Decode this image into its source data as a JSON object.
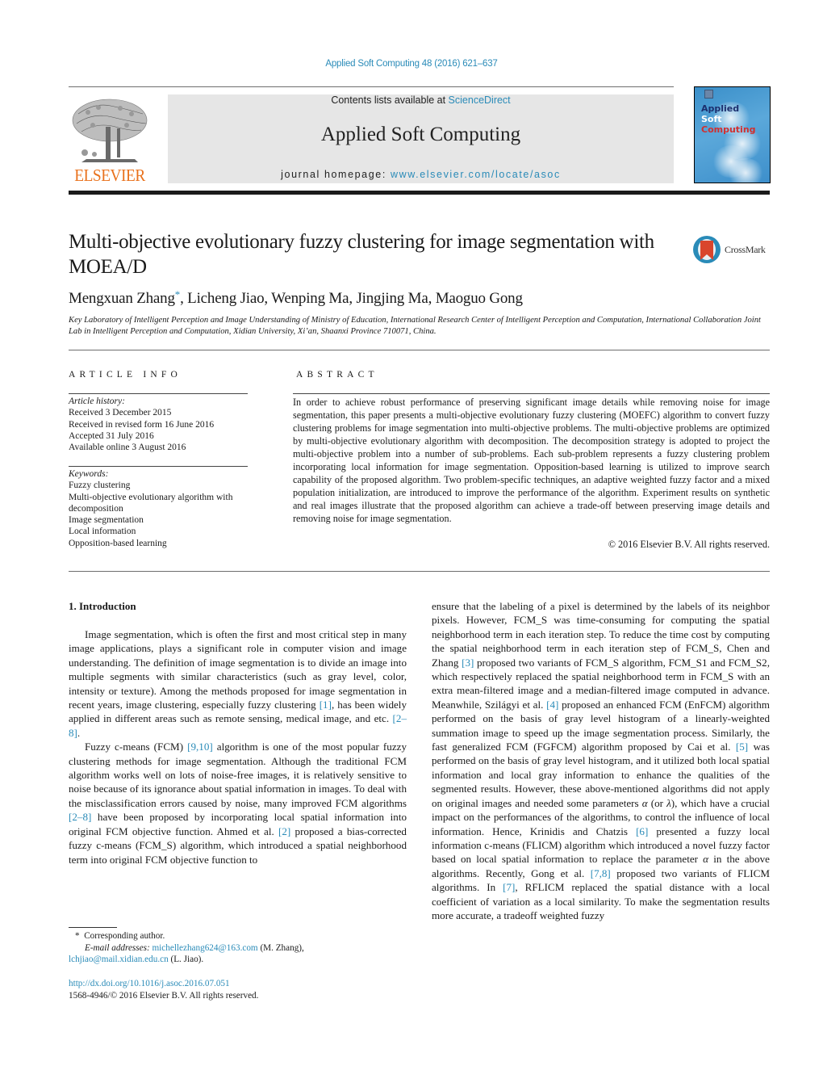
{
  "header": {
    "journal_ref": "Applied Soft Computing 48 (2016) 621–637",
    "contents_prefix": "Contents lists available at ",
    "contents_link": "ScienceDirect",
    "journal_title": "Applied Soft Computing",
    "homepage_prefix": "journal homepage: ",
    "homepage_link": "www.elsevier.com/locate/asoc",
    "publisher_logo_text": "ELSEVIER",
    "cover": {
      "line1": "Applied",
      "line2": "Soft",
      "line3": "Computing"
    },
    "colors": {
      "link": "#2a8bb8",
      "elsevier_orange": "#e9711c",
      "header_bg": "#e6e6e6"
    }
  },
  "article": {
    "title": "Multi-objective evolutionary fuzzy clustering for image segmentation with MOEA/D",
    "crossmark_label": "CrossMark",
    "authors": [
      {
        "name": "Mengxuan Zhang",
        "mark": "*"
      },
      {
        "name": "Licheng Jiao",
        "mark": ""
      },
      {
        "name": "Wenping Ma",
        "mark": ""
      },
      {
        "name": "Jingjing Ma",
        "mark": ""
      },
      {
        "name": "Maoguo Gong",
        "mark": ""
      }
    ],
    "affiliation": "Key Laboratory of Intelligent Perception and Image Understanding of Ministry of Education, International Research Center of Intelligent Perception and Computation, International Collaboration Joint Lab in Intelligent Perception and Computation, Xidian University, Xi’an, Shaanxi Province 710071, China."
  },
  "article_info": {
    "heading": "ARTICLE INFO",
    "history_label": "Article history:",
    "history": [
      "Received 3 December 2015",
      "Received in revised form 16 June 2016",
      "Accepted 31 July 2016",
      "Available online 3 August 2016"
    ],
    "keywords_label": "Keywords:",
    "keywords": [
      "Fuzzy clustering",
      "Multi-objective evolutionary algorithm with decomposition",
      "Image segmentation",
      "Local information",
      "Opposition-based learning"
    ]
  },
  "abstract": {
    "heading": "ABSTRACT",
    "text": "In order to achieve robust performance of preserving significant image details while removing noise for image segmentation, this paper presents a multi-objective evolutionary fuzzy clustering (MOEFC) algorithm to convert fuzzy clustering problems for image segmentation into multi-objective problems. The multi-objective problems are optimized by multi-objective evolutionary algorithm with decomposition. The decomposition strategy is adopted to project the multi-objective problem into a number of sub-problems. Each sub-problem represents a fuzzy clustering problem incorporating local information for image segmentation. Opposition-based learning is utilized to improve search capability of the proposed algorithm. Two problem-specific techniques, an adaptive weighted fuzzy factor and a mixed population initialization, are introduced to improve the performance of the algorithm. Experiment results on synthetic and real images illustrate that the proposed algorithm can achieve a trade-off between preserving image details and removing noise for image segmentation.",
    "copyright": "© 2016 Elsevier B.V. All rights reserved."
  },
  "body": {
    "section_heading": "1.  Introduction",
    "left_paragraphs": [
      [
        {
          "t": "Image segmentation, which is often the first and most critical step in many image applications, plays a significant role in computer vision and image understanding. The definition of image segmentation is to divide an image into multiple segments with similar characteristics (such as gray level, color, intensity or texture). Among the methods proposed for image segmentation in recent years, image clustering, especially fuzzy clustering "
        },
        {
          "c": "[1]"
        },
        {
          "t": ", has been widely applied in different areas such as remote sensing, medical image, and etc. "
        },
        {
          "c": "[2–8]"
        },
        {
          "t": "."
        }
      ],
      [
        {
          "t": "Fuzzy c-means (FCM) "
        },
        {
          "c": "[9,10]"
        },
        {
          "t": " algorithm is one of the most popular fuzzy clustering methods for image segmentation. Although the traditional FCM algorithm works well on lots of noise-free images, it is relatively sensitive to noise because of its ignorance about spatial information in images. To deal with the misclassification errors caused by noise, many improved FCM algorithms "
        },
        {
          "c": "[2–8]"
        },
        {
          "t": " have been proposed by incorporating local spatial information into original FCM objective function. Ahmed et al. "
        },
        {
          "c": "[2]"
        },
        {
          "t": " proposed a bias-corrected fuzzy c-means (FCM_S) algorithm, which introduced a spatial neighborhood term into original FCM objective function to"
        }
      ]
    ],
    "right_paragraphs": [
      [
        {
          "t": "ensure that the labeling of a pixel is determined by the labels of its neighbor pixels. However, FCM_S was time-consuming for computing the spatial neighborhood term in each iteration step. To reduce the time cost by computing the spatial neighborhood term in each iteration step of FCM_S, Chen and Zhang "
        },
        {
          "c": "[3]"
        },
        {
          "t": " proposed two variants of FCM_S algorithm, FCM_S1 and FCM_S2, which respectively replaced the spatial neighborhood term in FCM_S with an extra mean-filtered image and a median-filtered image computed in advance. Meanwhile, Szilágyi et al. "
        },
        {
          "c": "[4]"
        },
        {
          "t": " proposed an enhanced FCM (EnFCM) algorithm performed on the basis of gray level histogram of a linearly-weighted summation image to speed up the image segmentation process. Similarly, the fast generalized FCM (FGFCM) algorithm proposed by Cai et al. "
        },
        {
          "c": "[5]"
        },
        {
          "t": " was performed on the basis of gray level histogram, and it utilized both local spatial information and local gray information to enhance the qualities of the segmented results. However, these above-mentioned algorithms did not apply on original images and needed some parameters "
        },
        {
          "g": "α"
        },
        {
          "t": " (or "
        },
        {
          "g": "λ"
        },
        {
          "t": "), which have a crucial impact on the performances of the algorithms, to control the influence of local information. Hence, Krinidis and Chatzis "
        },
        {
          "c": "[6]"
        },
        {
          "t": " presented a fuzzy local information c-means (FLICM) algorithm which introduced a novel fuzzy factor based on local spatial information to replace the parameter "
        },
        {
          "g": "α"
        },
        {
          "t": " in the above algorithms. Recently, Gong et al. "
        },
        {
          "c": "[7,8]"
        },
        {
          "t": " proposed two variants of FLICM algorithms. In "
        },
        {
          "c": "[7]"
        },
        {
          "t": ", RFLICM replaced the spatial distance with a local coefficient of variation as a local similarity. To make the segmentation results more accurate, a tradeoff weighted fuzzy"
        }
      ]
    ]
  },
  "footnotes": {
    "star": "*",
    "corresponding": "Corresponding author.",
    "email_label": "E-mail addresses:",
    "email1": "michellezhang624@163.com",
    "email1_owner": " (M. Zhang),",
    "email2": "lchjiao@mail.xidian.edu.cn",
    "email2_owner": " (L. Jiao).",
    "doi": "http://dx.doi.org/10.1016/j.asoc.2016.07.051",
    "issn_line": "1568-4946/© 2016 Elsevier B.V. All rights reserved."
  }
}
